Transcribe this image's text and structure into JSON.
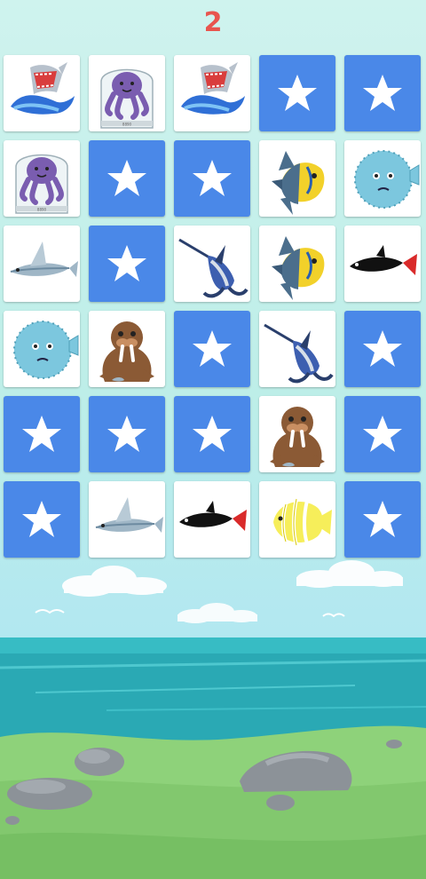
{
  "score": "2",
  "colors": {
    "card_back": "#4a88e8",
    "score": "#e8554e",
    "sky": "#c6f1ec",
    "sea": "#2aa9b4",
    "grass": "#8ed27a"
  },
  "grid": {
    "rows": 6,
    "cols": 5,
    "cards": [
      [
        "shark",
        "octopus",
        "shark",
        "back",
        "back"
      ],
      [
        "octopus",
        "back",
        "back",
        "angelfish",
        "pufferfish"
      ],
      [
        "flying-fish",
        "back",
        "marlin",
        "angelfish",
        "red-tail-shark"
      ],
      [
        "pufferfish",
        "walrus",
        "back",
        "marlin",
        "back"
      ],
      [
        "back",
        "back",
        "back",
        "walrus",
        "back"
      ],
      [
        "back",
        "flying-fish",
        "red-tail-shark",
        "butterflyfish",
        "back"
      ]
    ]
  }
}
